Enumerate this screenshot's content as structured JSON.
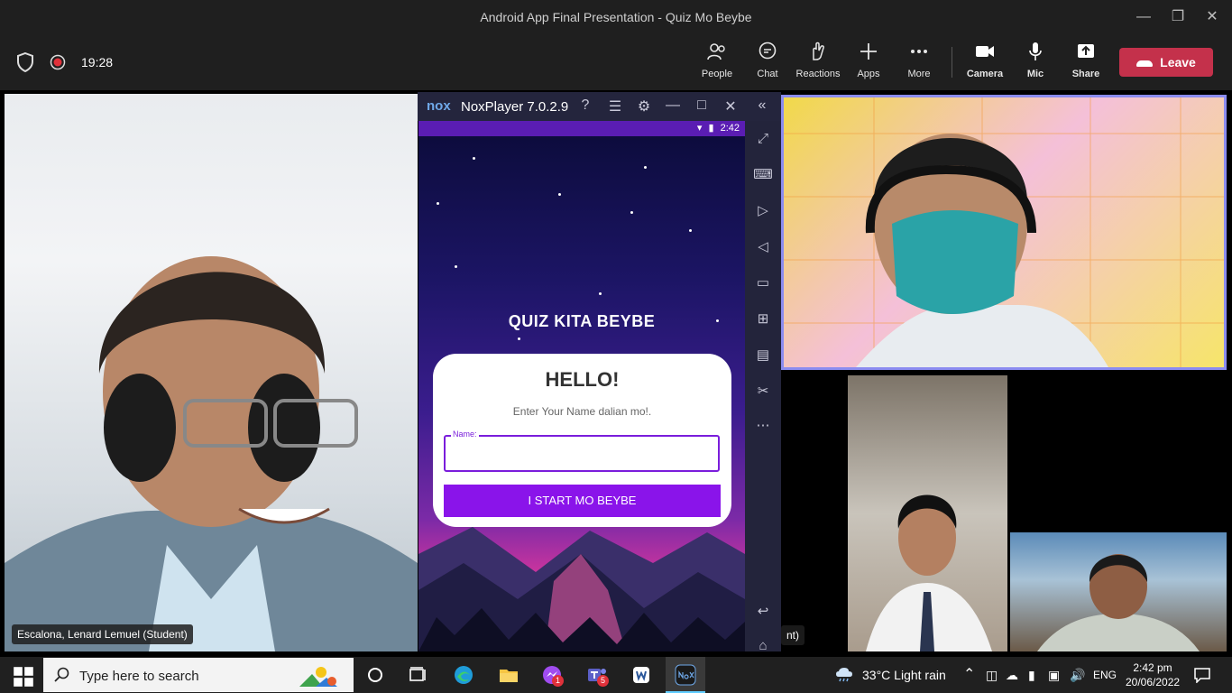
{
  "window": {
    "title": "Android App Final Presentation - Quiz Mo Beybe"
  },
  "meeting": {
    "timer": "19:28",
    "toolbar": {
      "people": "People",
      "chat": "Chat",
      "reactions": "Reactions",
      "apps": "Apps",
      "more": "More",
      "camera": "Camera",
      "mic": "Mic",
      "share": "Share",
      "leave": "Leave"
    },
    "participants": {
      "main_name": "Escalona, Lenard Lemuel (Student)",
      "truncated_tag": "nt)"
    }
  },
  "nox": {
    "title": "NoxPlayer 7.0.2.9",
    "logo": "nox",
    "status_time": "2:42"
  },
  "app": {
    "title": "QUIZ KITA BEYBE",
    "greeting": "HELLO!",
    "prompt": "Enter Your Name dalian mo!.",
    "name_label": "Name:",
    "name_value": "",
    "start_button": "I START MO BEYBE"
  },
  "taskbar": {
    "search_placeholder": "Type here to search",
    "weather": "33°C  Light rain",
    "language": "ENG",
    "time": "2:42 pm",
    "date": "20/06/2022",
    "teams_badge": "5",
    "messenger_badge": "1"
  },
  "colors": {
    "leave": "#c4314b",
    "accent": "#8a14ea",
    "active_speaker_border": "#8b8cf0"
  }
}
